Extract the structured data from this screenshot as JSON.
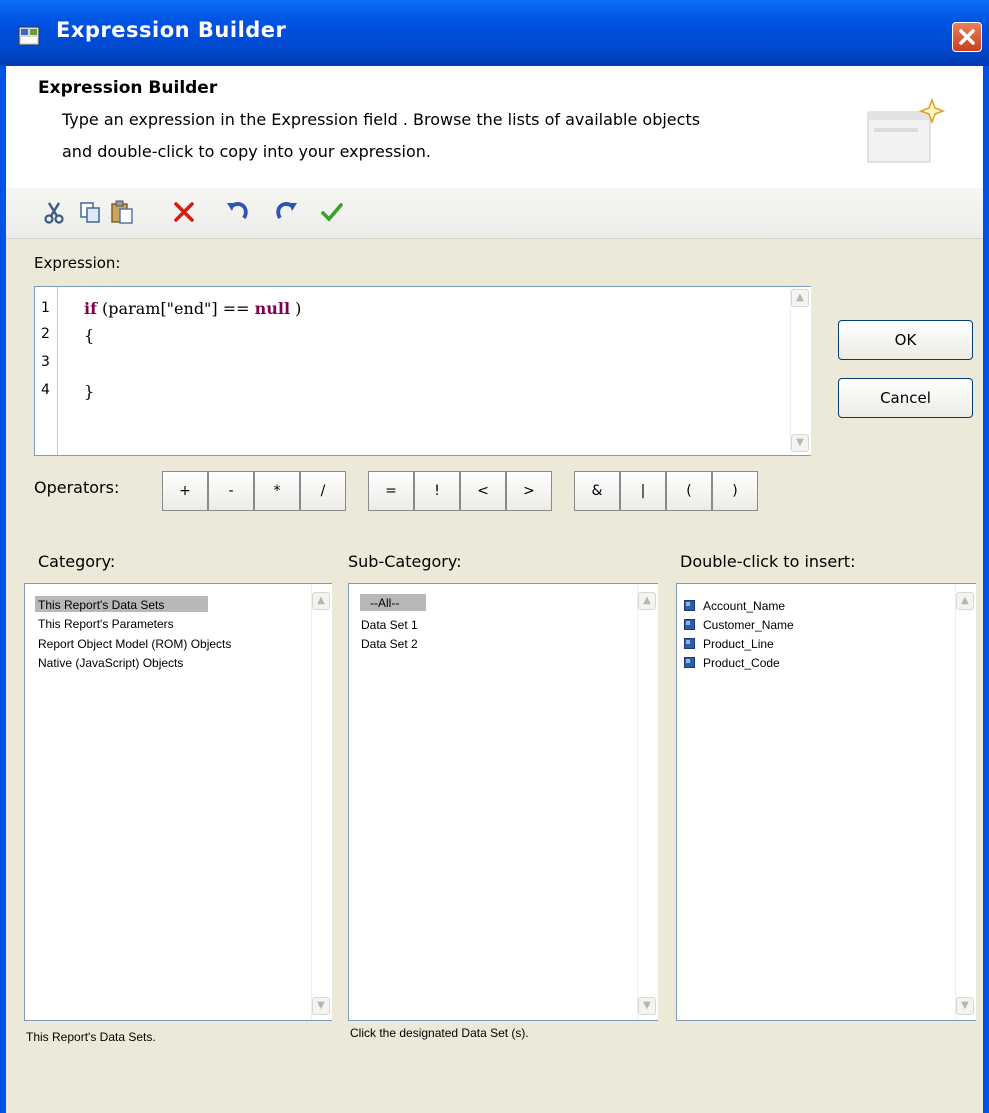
{
  "window": {
    "title": "Expression Builder"
  },
  "header": {
    "title": "Expression Builder",
    "desc_line1": "Type an expression in the Expression field .  Browse the lists of available objects",
    "desc_line2": "and double-click to copy into your expression."
  },
  "toolbar": {
    "items": [
      "cut-icon",
      "copy-icon",
      "paste-icon",
      "delete-icon",
      "undo-icon",
      "redo-icon",
      "validate-icon"
    ]
  },
  "editor": {
    "label": "Expression:",
    "line_numbers": [
      "1",
      "2",
      "3",
      "4"
    ],
    "lines": [
      {
        "kw1": "if",
        "t1": " (param[\"end\"] == ",
        "kw2": "null",
        "t2": " )"
      },
      {
        "text": "{"
      },
      {
        "text": ""
      },
      {
        "text": "}"
      }
    ]
  },
  "buttons": {
    "ok": "OK",
    "cancel": "Cancel"
  },
  "operators": {
    "label": "Operators:",
    "items": [
      "+",
      "-",
      "*",
      "/",
      "=",
      "!",
      "<",
      ">",
      "&",
      "|",
      "(",
      ")"
    ]
  },
  "category": {
    "label": "Category:",
    "items": [
      "This Report's Data Sets",
      "This Report's Parameters",
      "Report Object Model (ROM) Objects",
      "Native (JavaScript) Objects"
    ],
    "hint": "This Report's Data Sets."
  },
  "subcategory": {
    "label": "Sub-Category:",
    "items": [
      "--All--",
      "Data Set 1",
      "Data Set 2"
    ],
    "hint": "Click the designated Data Set (s)."
  },
  "insert": {
    "label": "Double-click to insert:",
    "items": [
      "Account_Name",
      "Customer_Name",
      "Product_Line",
      "Product_Code"
    ]
  },
  "colors": {
    "titlebar": "#0054e3",
    "dialog_bg": "#ece9d8",
    "keyword": "#7f0055"
  }
}
